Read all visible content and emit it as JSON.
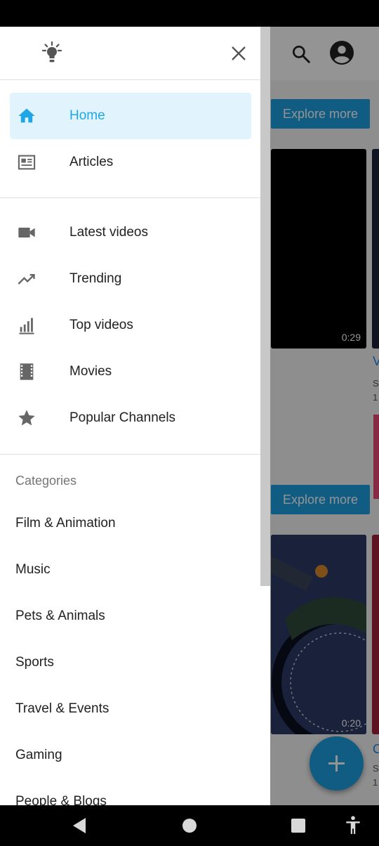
{
  "background": {
    "explore_more_1": "Explore more",
    "explore_more_2": "Explore more",
    "video_1_duration": "0:29",
    "video_2_duration": "0:20",
    "partial_title_1": "V",
    "partial_sub_1a": "S",
    "partial_sub_1b": "1",
    "partial_title_2": "C",
    "partial_sub_2a": "S",
    "partial_sub_2b": "1"
  },
  "drawer": {
    "primary_nav": [
      {
        "label": "Home",
        "icon": "home-icon",
        "active": true
      },
      {
        "label": "Articles",
        "icon": "article-icon",
        "active": false
      }
    ],
    "secondary_nav": [
      {
        "label": "Latest videos",
        "icon": "videocam-icon"
      },
      {
        "label": "Trending",
        "icon": "trending-up-icon"
      },
      {
        "label": "Top videos",
        "icon": "bar-chart-icon"
      },
      {
        "label": "Movies",
        "icon": "movie-icon"
      },
      {
        "label": "Popular Channels",
        "icon": "star-icon"
      }
    ],
    "categories_heading": "Categories",
    "categories": [
      "Film & Animation",
      "Music",
      "Pets & Animals",
      "Sports",
      "Travel & Events",
      "Gaming",
      "People & Blogs"
    ]
  },
  "colors": {
    "accent": "#1ea7e4",
    "active_bg": "#e1f4fd",
    "fab": "#1e9fe0"
  }
}
